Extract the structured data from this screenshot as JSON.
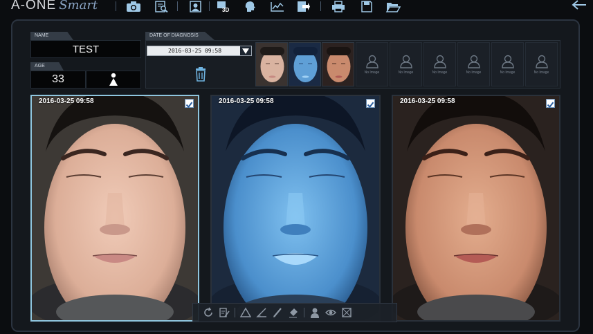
{
  "app": {
    "logo_main": "A-ONE",
    "logo_script": "Smart"
  },
  "toolbar": {
    "icons": [
      "camera-icon",
      "search-document-icon",
      "patient-card-icon",
      "3d-icon",
      "face-profile-icon",
      "chart-icon",
      "export-icon",
      "print-icon",
      "save-icon",
      "open-folder-icon"
    ],
    "badge_3d": "3D",
    "back_icon": "back-arrow-icon"
  },
  "patient": {
    "name_label": "NAME",
    "name": "TEST",
    "age_label": "AGE",
    "age": "33",
    "gender_icon": "person-icon"
  },
  "diagnosis": {
    "label": "DATE OF DIAGNOSIS",
    "selected_date": "2016-03-25 09:58",
    "empty_label": "No Image"
  },
  "panels": [
    {
      "timestamp": "2016-03-25 09:58",
      "checked": true,
      "mode": "normal"
    },
    {
      "timestamp": "2016-03-25 09:58",
      "checked": true,
      "mode": "uv"
    },
    {
      "timestamp": "2016-03-25 09:58",
      "checked": true,
      "mode": "polarized"
    }
  ],
  "colors": {
    "accent": "#8fc6df",
    "icon": "#9fc8e6",
    "background": "#14181d"
  }
}
